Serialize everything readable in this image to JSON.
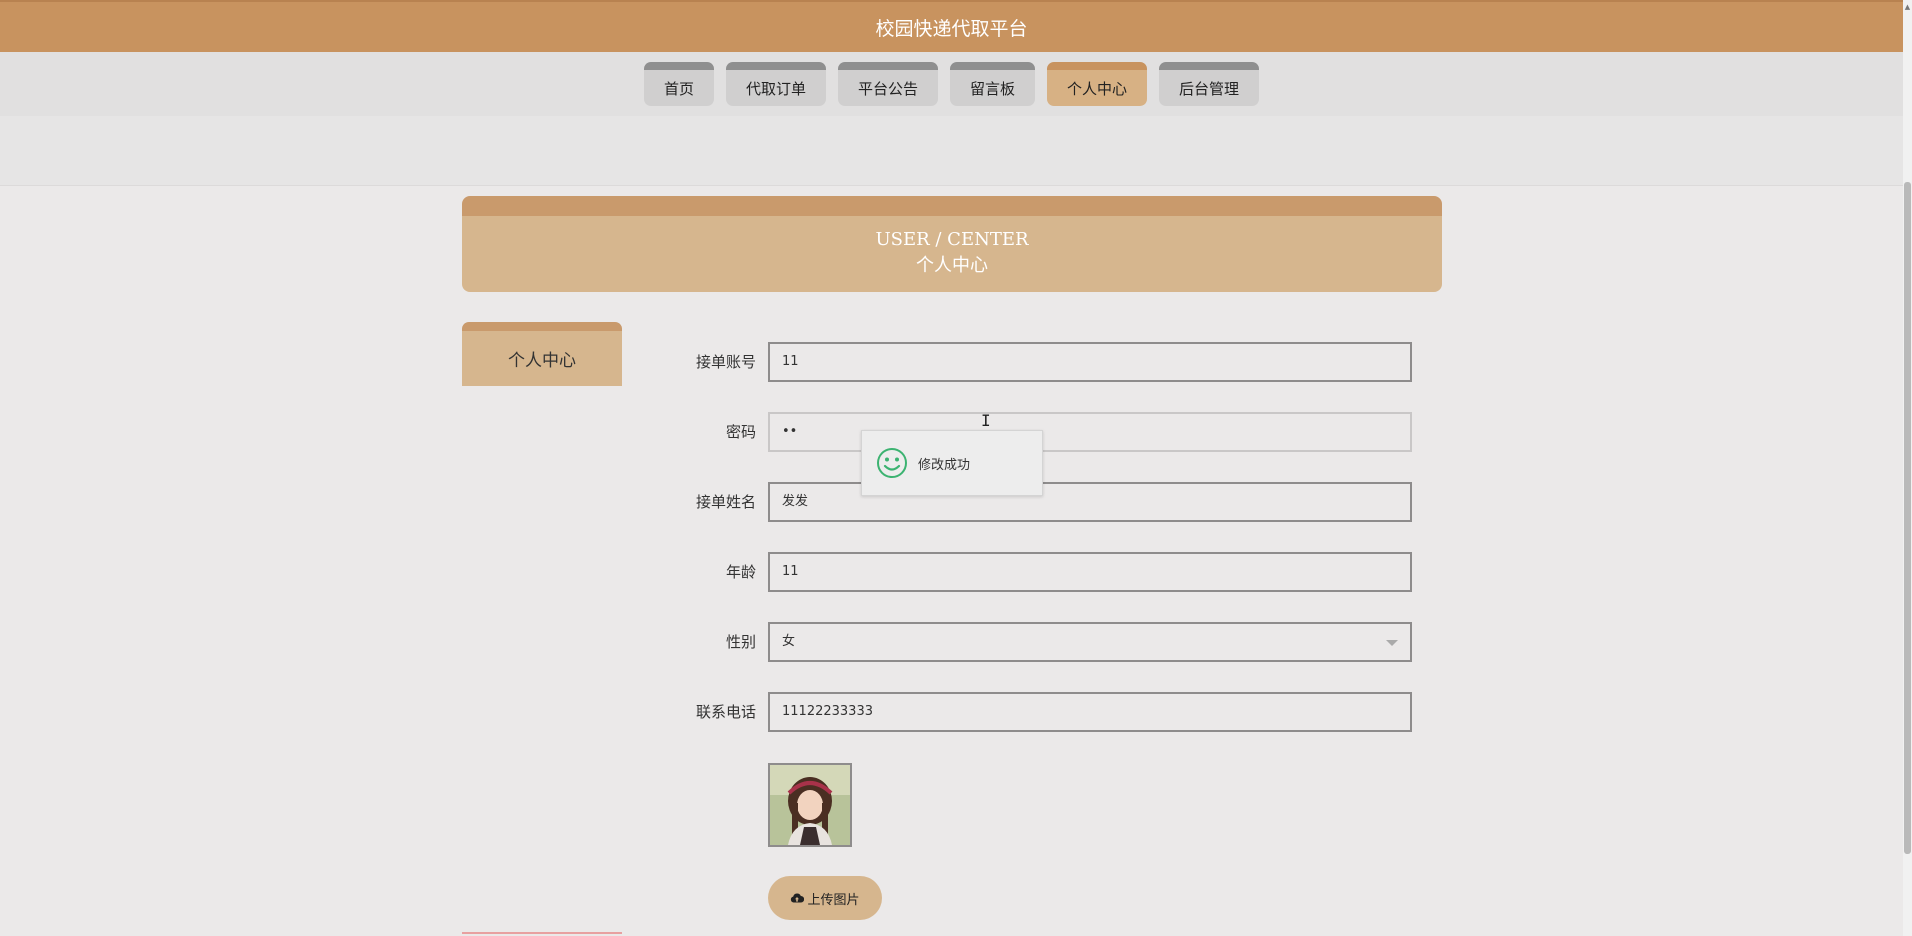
{
  "header": {
    "title": "校园快递代取平台"
  },
  "nav": {
    "items": [
      {
        "label": "首页",
        "active": false
      },
      {
        "label": "代取订单",
        "active": false
      },
      {
        "label": "平台公告",
        "active": false
      },
      {
        "label": "留言板",
        "active": false
      },
      {
        "label": "个人中心",
        "active": true
      },
      {
        "label": "后台管理",
        "active": false
      }
    ]
  },
  "banner": {
    "title_en": "USER / CENTER",
    "title_cn": "个人中心"
  },
  "sidebar": {
    "tab_label": "个人中心"
  },
  "form": {
    "account_label": "接单账号",
    "account_value": "11",
    "password_label": "密码",
    "password_value": "••",
    "name_label": "接单姓名",
    "name_value": "发发",
    "age_label": "年龄",
    "age_value": "11",
    "gender_label": "性别",
    "gender_value": "女",
    "phone_label": "联系电话",
    "phone_value": "11122233333",
    "upload_label": "上传图片"
  },
  "toast": {
    "message": "修改成功",
    "icon": "smiley-icon"
  },
  "colors": {
    "brand": "#c8935f",
    "brand_light": "#d6b68e",
    "background": "#ebe9e9",
    "toast_icon": "#3cb371"
  }
}
